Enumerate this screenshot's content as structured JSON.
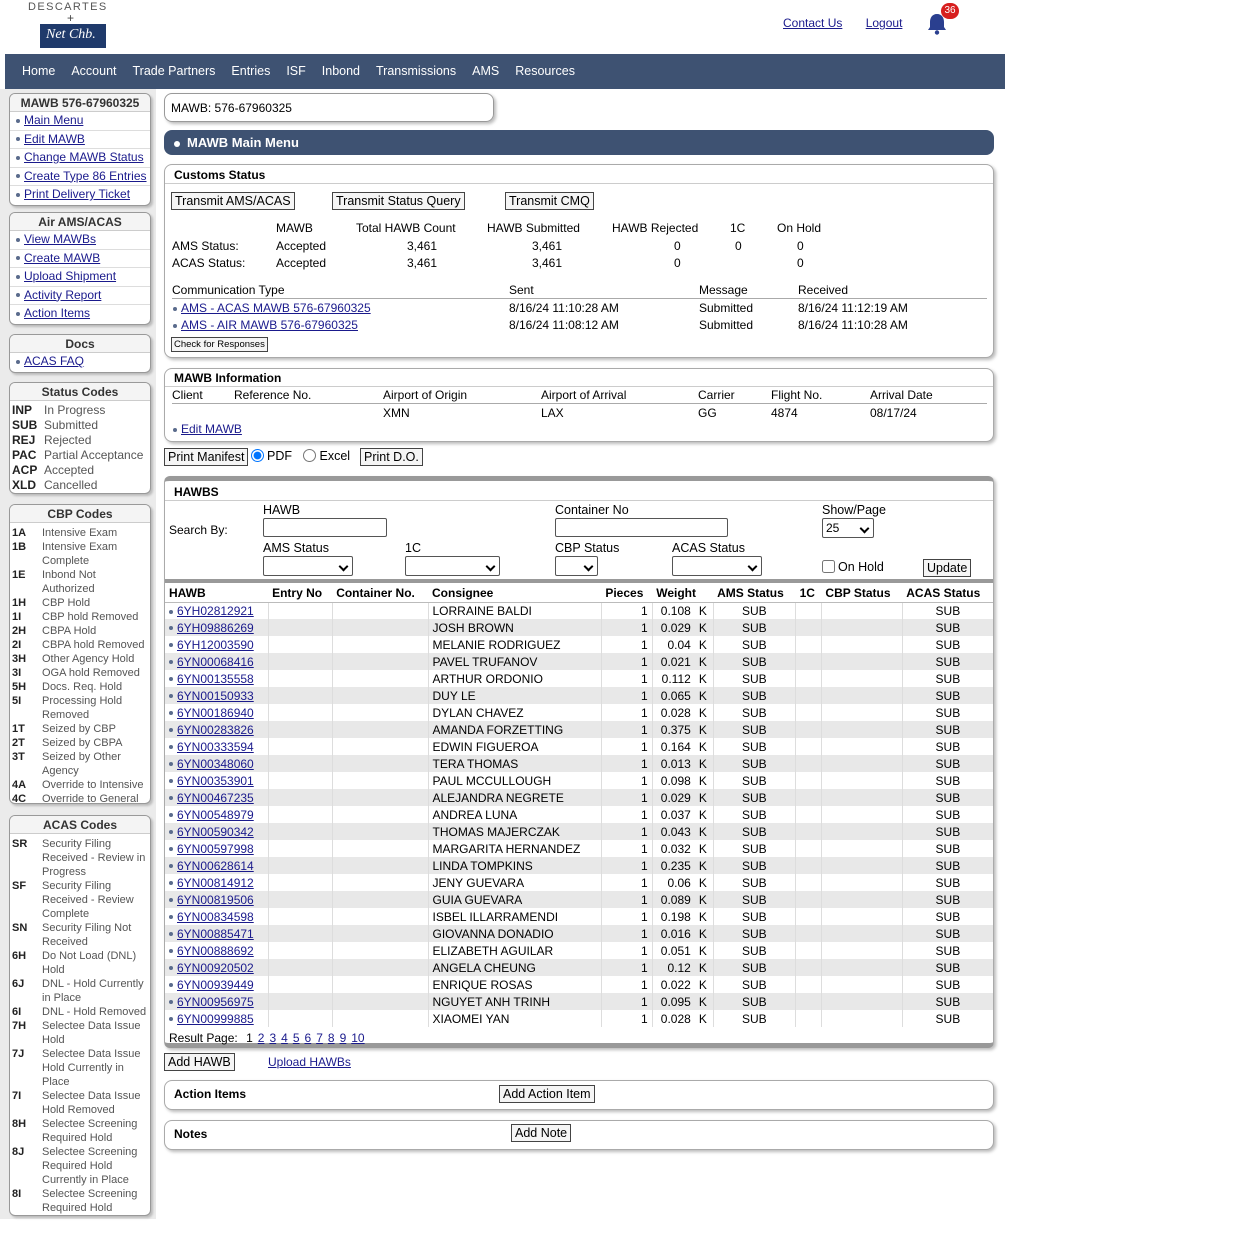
{
  "logo": {
    "line1": "DESCARTES",
    "plus": "+",
    "line2": "Net Chb."
  },
  "top_links": {
    "contact": "Contact Us",
    "logout": "Logout",
    "notif_count": "36"
  },
  "nav": [
    "Home",
    "Account",
    "Trade Partners",
    "Entries",
    "ISF",
    "Inbond",
    "Transmissions",
    "AMS",
    "Resources"
  ],
  "sidebar": {
    "mawb_box": {
      "title": "MAWB 576-67960325",
      "items": [
        "Main Menu",
        "Edit MAWB",
        "Change MAWB Status",
        "Create Type 86 Entries",
        "Print Delivery Ticket"
      ]
    },
    "ams_box": {
      "title": "Air AMS/ACAS",
      "items": [
        "View MAWBs",
        "Create MAWB",
        "Upload Shipment",
        "Activity Report",
        "Action Items"
      ]
    },
    "docs_box": {
      "title": "Docs",
      "items": [
        "ACAS FAQ"
      ]
    },
    "status_codes": {
      "title": "Status Codes",
      "rows": [
        {
          "c": "INP",
          "d": "In Progress"
        },
        {
          "c": "SUB",
          "d": "Submitted"
        },
        {
          "c": "REJ",
          "d": "Rejected"
        },
        {
          "c": "PAC",
          "d": "Partial Acceptance"
        },
        {
          "c": "ACP",
          "d": "Accepted"
        },
        {
          "c": "XLD",
          "d": "Cancelled"
        }
      ]
    },
    "cbp_codes": {
      "title": "CBP Codes",
      "rows": [
        {
          "c": "1A",
          "d": "Intensive Exam"
        },
        {
          "c": "1B",
          "d": "Intensive Exam Complete"
        },
        {
          "c": "1E",
          "d": "Inbond Not Authorized"
        },
        {
          "c": "1H",
          "d": "CBP Hold"
        },
        {
          "c": "1I",
          "d": "CBP hold Removed"
        },
        {
          "c": "2H",
          "d": "CBPA Hold"
        },
        {
          "c": "2I",
          "d": "CBPA hold Removed"
        },
        {
          "c": "3H",
          "d": "Other Agency Hold"
        },
        {
          "c": "3I",
          "d": "OGA hold Removed"
        },
        {
          "c": "5H",
          "d": "Docs. Req. Hold"
        },
        {
          "c": "5I",
          "d": "Processing Hold Removed"
        },
        {
          "c": "1T",
          "d": "Seized by CBP"
        },
        {
          "c": "2T",
          "d": "Seized by CBPA"
        },
        {
          "c": "3T",
          "d": "Seized by Other Agency"
        },
        {
          "c": "4A",
          "d": "Override to Intensive"
        },
        {
          "c": "4C",
          "d": "Override to General"
        }
      ]
    },
    "acas_codes": {
      "title": "ACAS Codes",
      "rows": [
        {
          "c": "SR",
          "d": "Security Filing Received - Review in Progress"
        },
        {
          "c": "SF",
          "d": "Security Filing Received - Review Complete"
        },
        {
          "c": "SN",
          "d": "Security Filing Not Received"
        },
        {
          "c": "6H",
          "d": "Do Not Load (DNL) Hold"
        },
        {
          "c": "6J",
          "d": "DNL - Hold Currently in Place"
        },
        {
          "c": "6I",
          "d": "DNL - Hold Removed"
        },
        {
          "c": "7H",
          "d": "Selectee Data Issue Hold"
        },
        {
          "c": "7J",
          "d": "Selectee Data Issue Hold Currently in Place"
        },
        {
          "c": "7I",
          "d": "Selectee Data Issue Hold Removed"
        },
        {
          "c": "8H",
          "d": "Selectee Screening Required Hold"
        },
        {
          "c": "8J",
          "d": "Selectee Screening Required Hold Currently in Place"
        },
        {
          "c": "8I",
          "d": "Selectee Screening Required Hold Removed"
        }
      ]
    }
  },
  "mawb_label": "MAWB: 576-67960325",
  "main_menu_title": "MAWB Main Menu",
  "customs": {
    "title": "Customs Status",
    "buttons": [
      "Transmit AMS/ACAS",
      "Transmit Status Query",
      "Transmit CMQ"
    ],
    "headers": [
      "MAWB",
      "Total HAWB Count",
      "HAWB Submitted",
      "HAWB Rejected",
      "1C",
      "On Hold"
    ],
    "rows": [
      {
        "label": "AMS Status:",
        "mawb": "Accepted",
        "total": "3,461",
        "sub": "3,461",
        "rej": "0",
        "c1": "0",
        "hold": "0"
      },
      {
        "label": "ACAS Status:",
        "mawb": "Accepted",
        "total": "3,461",
        "sub": "3,461",
        "rej": "0",
        "c1": "",
        "hold": "0"
      }
    ],
    "comm_headers": [
      "Communication Type",
      "Sent",
      "Message",
      "Received"
    ],
    "comm_rows": [
      {
        "type": "AMS - ACAS MAWB 576-67960325",
        "sent": "8/16/24 11:10:28 AM",
        "msg": "Submitted",
        "recv": "8/16/24 11:12:19 AM"
      },
      {
        "type": "AMS - AIR MAWB 576-67960325",
        "sent": "8/16/24 11:08:12 AM",
        "msg": "Submitted",
        "recv": "8/16/24 11:10:28 AM"
      }
    ],
    "check_btn": "Check for Responses"
  },
  "mawb_info": {
    "title": "MAWB Information",
    "headers": [
      "Client",
      "Reference No.",
      "Airport of Origin",
      "Airport of Arrival",
      "Carrier",
      "Flight No.",
      "Arrival Date"
    ],
    "values": [
      "",
      "",
      "XMN",
      "LAX",
      "GG",
      "4874",
      "08/17/24"
    ],
    "edit": "Edit MAWB"
  },
  "print": {
    "manifest": "Print Manifest",
    "pdf": "PDF",
    "excel": "Excel",
    "do": "Print D.O."
  },
  "hawbs": {
    "title": "HAWBS",
    "search_by": "Search By:",
    "labels": {
      "hawb": "HAWB",
      "container": "Container No",
      "show": "Show/Page",
      "ams": "AMS Status",
      "c1": "1C",
      "cbp": "CBP Status",
      "acas": "ACAS Status",
      "hold": "On Hold",
      "update": "Update",
      "show_val": "25"
    },
    "columns": [
      "HAWB",
      "Entry No",
      "Container No.",
      "Consignee",
      "Pieces",
      "Weight",
      "AMS Status",
      "1C",
      "CBP Status",
      "ACAS Status"
    ],
    "rows": [
      [
        "6YH02812921",
        "LORRAINE BALDI",
        "1",
        "0.108"
      ],
      [
        "6YH09886269",
        "JOSH BROWN",
        "1",
        "0.029"
      ],
      [
        "6YH12003590",
        "MELANIE RODRIGUEZ",
        "1",
        "0.04"
      ],
      [
        "6YN00068416",
        "PAVEL TRUFANOV",
        "1",
        "0.021"
      ],
      [
        "6YN00135558",
        "ARTHUR ORDONIO",
        "1",
        "0.112"
      ],
      [
        "6YN00150933",
        "DUY LE",
        "1",
        "0.065"
      ],
      [
        "6YN00186940",
        "DYLAN CHAVEZ",
        "1",
        "0.028"
      ],
      [
        "6YN00283826",
        "AMANDA FORZETTING",
        "1",
        "0.375"
      ],
      [
        "6YN00333594",
        "EDWIN FIGUEROA",
        "1",
        "0.164"
      ],
      [
        "6YN00348060",
        "TERA THOMAS",
        "1",
        "0.013"
      ],
      [
        "6YN00353901",
        "PAUL MCCULLOUGH",
        "1",
        "0.098"
      ],
      [
        "6YN00467235",
        "ALEJANDRA NEGRETE",
        "1",
        "0.029"
      ],
      [
        "6YN00548979",
        "ANDREA LUNA",
        "1",
        "0.037"
      ],
      [
        "6YN00590342",
        "THOMAS MAJERCZAK",
        "1",
        "0.043"
      ],
      [
        "6YN00597998",
        "MARGARITA HERNANDEZ",
        "1",
        "0.032"
      ],
      [
        "6YN00628614",
        "LINDA TOMPKINS",
        "1",
        "0.235"
      ],
      [
        "6YN00814912",
        "JENY GUEVARA",
        "1",
        "0.06"
      ],
      [
        "6YN00819506",
        "GUIA GUEVARA",
        "1",
        "0.089"
      ],
      [
        "6YN00834598",
        "ISBEL ILLARRAMENDI",
        "1",
        "0.198"
      ],
      [
        "6YN00885471",
        "GIOVANNA DONADIO",
        "1",
        "0.016"
      ],
      [
        "6YN00888692",
        "ELIZABETH AGUILAR",
        "1",
        "0.051"
      ],
      [
        "6YN00920502",
        "ANGELA CHEUNG",
        "1",
        "0.12"
      ],
      [
        "6YN00939449",
        "ENRIQUE ROSAS",
        "1",
        "0.022"
      ],
      [
        "6YN00956975",
        "NGUYET ANH TRINH",
        "1",
        "0.095"
      ],
      [
        "6YN00999885",
        "XIAOMEI YAN",
        "1",
        "0.028"
      ]
    ],
    "unit": "K",
    "status": "SUB",
    "result_page_label": "Result Page:",
    "pages": [
      "1",
      "2",
      "3",
      "4",
      "5",
      "6",
      "7",
      "8",
      "9",
      "10"
    ]
  },
  "add_hawb": "Add HAWB",
  "upload_hawbs": "Upload HAWBs",
  "action_items": {
    "title": "Action Items",
    "btn": "Add Action Item"
  },
  "notes": {
    "title": "Notes",
    "btn": "Add Note"
  }
}
